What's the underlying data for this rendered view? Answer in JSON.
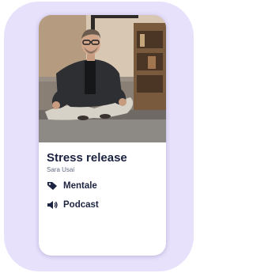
{
  "card": {
    "title": "Stress release",
    "author": "Sara Usai",
    "tags": [
      {
        "icon": "tag-icon",
        "label": "Mentale"
      },
      {
        "icon": "speaker-icon",
        "label": "Podcast"
      }
    ]
  },
  "colors": {
    "background_panel": "#e7e1fb",
    "card": "#ffffff",
    "text_dark": "#1c2340",
    "text_muted": "#646b80"
  }
}
